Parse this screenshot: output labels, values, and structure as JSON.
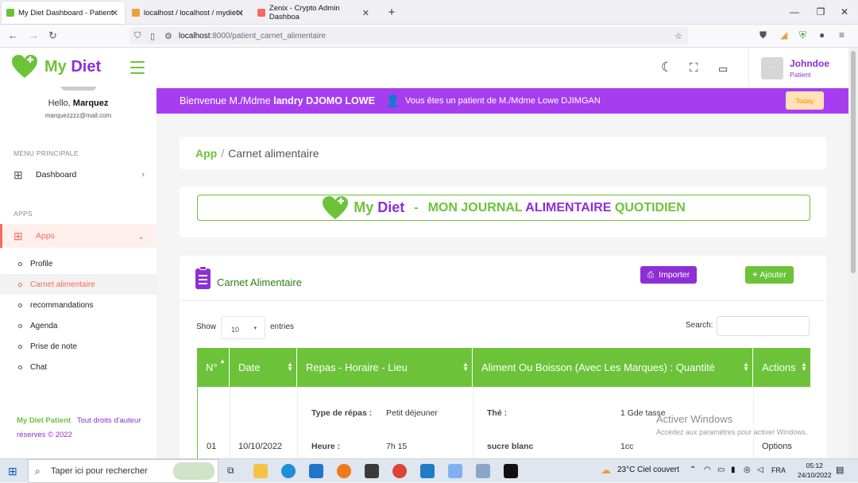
{
  "browser": {
    "tabs": [
      {
        "title": "My Diet Dashboard - Patient",
        "active": true
      },
      {
        "title": "localhost / localhost / mydiet /",
        "active": false
      },
      {
        "title": "Zenix - Crypto Admin Dashboa",
        "active": false
      }
    ],
    "url_host": "localhost",
    "url_path": ":8000/patient_carnet_alimentaire"
  },
  "header": {
    "brand_my": "My",
    "brand_diet": "Diet",
    "user_name": "Johndoe",
    "user_role": "Patient",
    "avatar_text": "---"
  },
  "sidebar": {
    "hello_prefix": "Hello, ",
    "hello_name": "Marquez",
    "email": "marquezzzz@mail.com",
    "menu_section": "MENU PRINCIPALE",
    "dashboard": "Dashboard",
    "apps_section": "APPS",
    "apps": "Apps",
    "sub_items": [
      "Profile",
      "Carnet alimentaire",
      "recommandations",
      "Agenda",
      "Prise de note",
      "Chat"
    ],
    "footer_brand": "My Diet Patient",
    "footer_rights": "Tout droits d'auteur réservés © 2022"
  },
  "banner": {
    "welcome": "Bienvenue M./Mdme",
    "patient_name": "landry DJOMO LOWE",
    "doctor_text": "Vous êtes un patient de M./Mdme Lowe DJIMGAN",
    "today": "Today"
  },
  "breadcrumb": {
    "root": "App",
    "current": "Carnet alimentaire"
  },
  "journal": {
    "brand_my": "My",
    "brand_diet": "Diet",
    "dash": "-",
    "title_1": "MON JOURNAL",
    "title_2": "ALIMENTAIRE",
    "title_3": "QUOTIDIEN"
  },
  "carnet": {
    "title": "Carnet Alimentaire",
    "import_label": "Importer",
    "add_label": "Ajouter",
    "show_label": "Show",
    "entries_value": "10",
    "entries_label": "entries",
    "search_label": "Search:",
    "columns": [
      "N°",
      "Date",
      "Repas - Horaire - Lieu",
      "Aliment Ou Boisson (Avec Les Marques) : Quantité",
      "Actions"
    ],
    "row": {
      "num": "01",
      "date": "10/10/2022",
      "meal_type_label": "Type de répas :",
      "meal_type_value": "Petit déjeuner",
      "time_label": "Heure :",
      "time_value": "7h 15",
      "food1": "Thé :",
      "qty1": "1 Gde tasse",
      "food2": "sucre blanc",
      "qty2": "1cc",
      "actions": "Options"
    }
  },
  "watermark": {
    "line1": "Activer Windows",
    "line2": "Accédez aux paramètres pour activer Windows."
  },
  "taskbar": {
    "search_placeholder": "Taper ici pour rechercher",
    "weather": "23°C Ciel couvert",
    "lang": "FRA",
    "time": "05:12",
    "date": "24/10/2022"
  },
  "colors": {
    "green": "#6cc33a",
    "purple": "#8e2fd6",
    "banner": "#a63ef0",
    "accent": "#f36b5a"
  }
}
